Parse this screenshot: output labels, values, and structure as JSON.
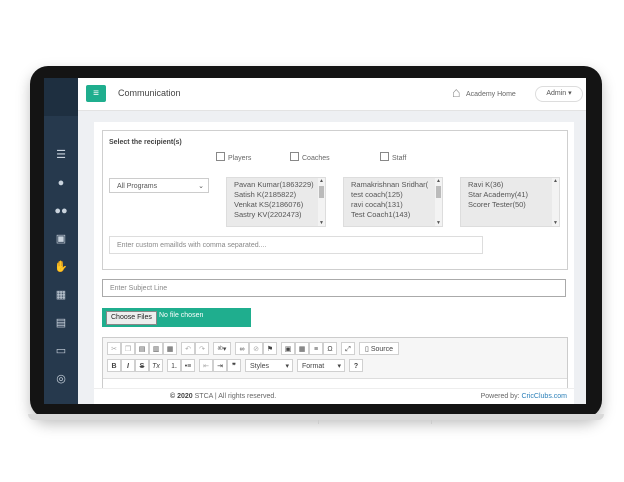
{
  "header": {
    "page_title": "Communication",
    "home_label": "Academy Home",
    "admin_label": "Admin"
  },
  "recipients": {
    "title": "Select the recipient(s)",
    "checkboxes": [
      "Players",
      "Coaches",
      "Staff"
    ],
    "program_select": "All Programs",
    "players": [
      "Pavan Kumar(1863229)",
      "Satish K(2185822)",
      "Venkat KS(2186076)",
      "Sastry KV(2202473)"
    ],
    "coaches": [
      "Ramakrishnan Sridhar(",
      "test coach(125)",
      "ravi cocah(131)",
      "Test Coach1(143)"
    ],
    "staff": [
      "Ravi K(36)",
      "Star Academy(41)",
      "Scorer Tester(50)"
    ],
    "custom_email_placeholder": "Enter custom emailIds with comma separated...."
  },
  "subject_placeholder": "Enter Subject Line",
  "file": {
    "button_label": "Choose Files",
    "status": "No file chosen"
  },
  "editor": {
    "source_label": "Source",
    "styles_label": "Styles",
    "format_label": "Format"
  },
  "footer": {
    "copyright_year": "© 2020",
    "copyright_rest": "STCA | All rights reserved.",
    "powered_by": "Powered by:",
    "powered_link": "CricClubs.com"
  },
  "colors": {
    "accent": "#1fae8e",
    "sidebar": "#26394d",
    "link": "#2a7fb8"
  }
}
